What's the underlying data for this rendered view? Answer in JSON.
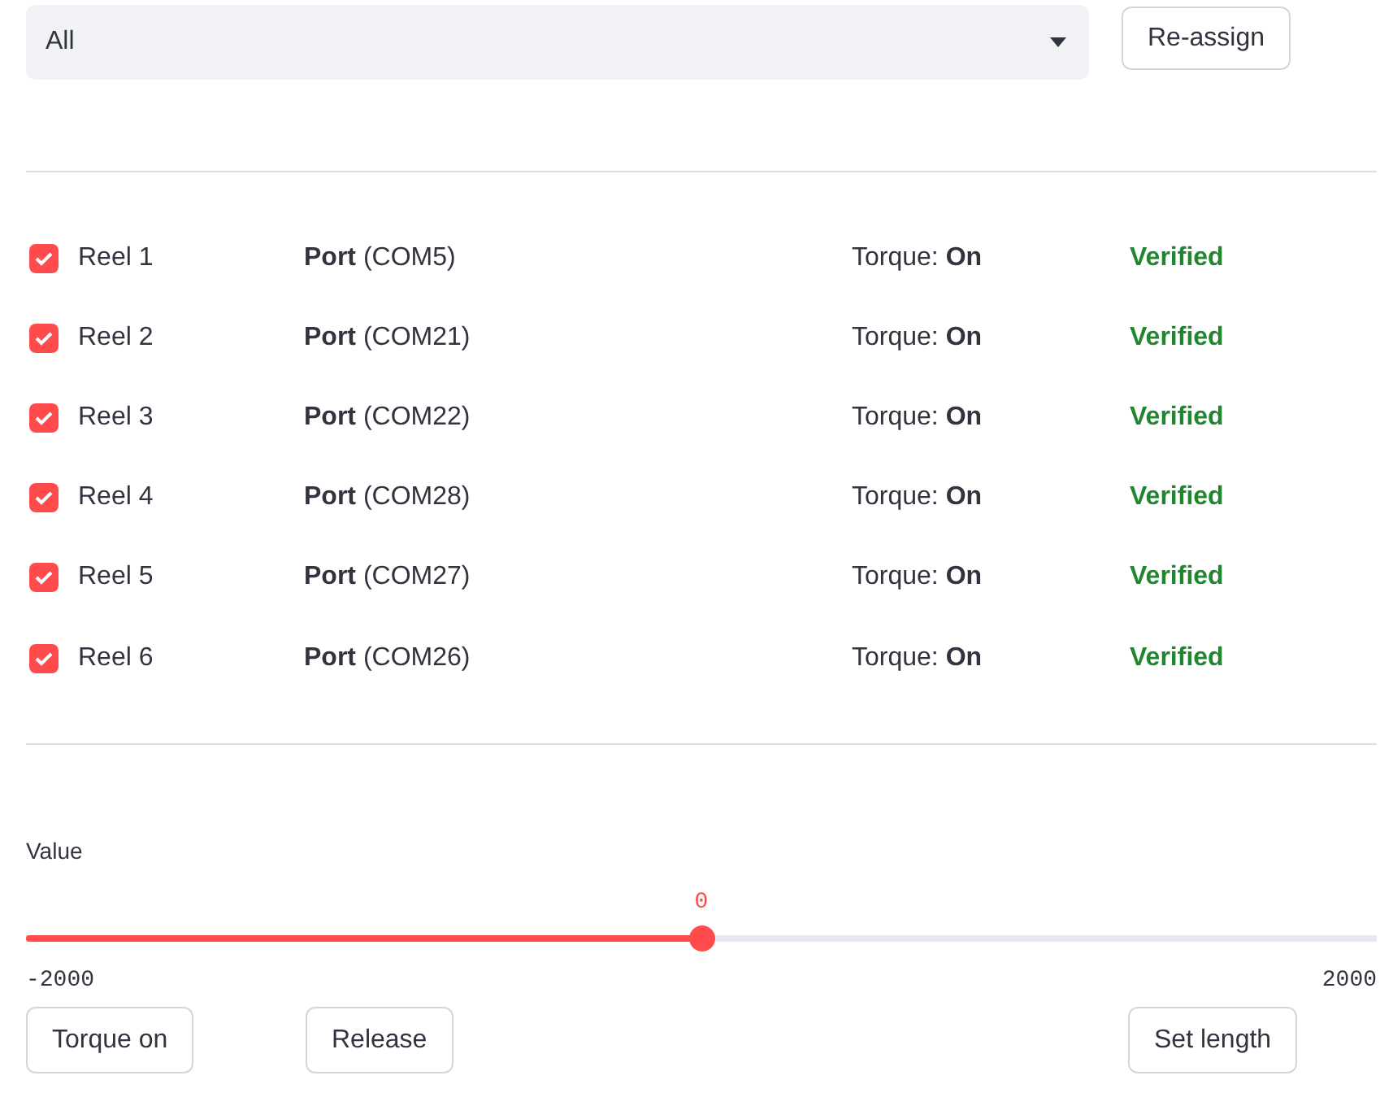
{
  "filter": {
    "value": "All"
  },
  "reassign_button": "Re-assign",
  "reels": [
    {
      "label": "Reel 1",
      "checked": true,
      "port": "**Port** (COM5)",
      "torque": "Torque: **On**",
      "status": "Verified"
    },
    {
      "label": "Reel 2",
      "checked": true,
      "port": "**Port** (COM21)",
      "torque": "Torque: **On**",
      "status": "Verified"
    },
    {
      "label": "Reel 3",
      "checked": true,
      "port": "**Port** (COM22)",
      "torque": "Torque: **On**",
      "status": "Verified"
    },
    {
      "label": "Reel 4",
      "checked": true,
      "port": "**Port** (COM28)",
      "torque": "Torque: **On**",
      "status": "Verified"
    },
    {
      "label": "Reel 5",
      "checked": true,
      "port": "**Port** (COM27)",
      "torque": "Torque: **On**",
      "status": "Verified"
    },
    {
      "label": "Reel 6",
      "checked": true,
      "port": "**Port** (COM26)",
      "torque": "Torque: **On**",
      "status": "Verified"
    }
  ],
  "slider": {
    "label": "Value",
    "reading": "0",
    "level": 0.5,
    "min": "-2000",
    "max": "2000"
  },
  "buttons": [
    "Torque on",
    "Release",
    "Set length"
  ]
}
